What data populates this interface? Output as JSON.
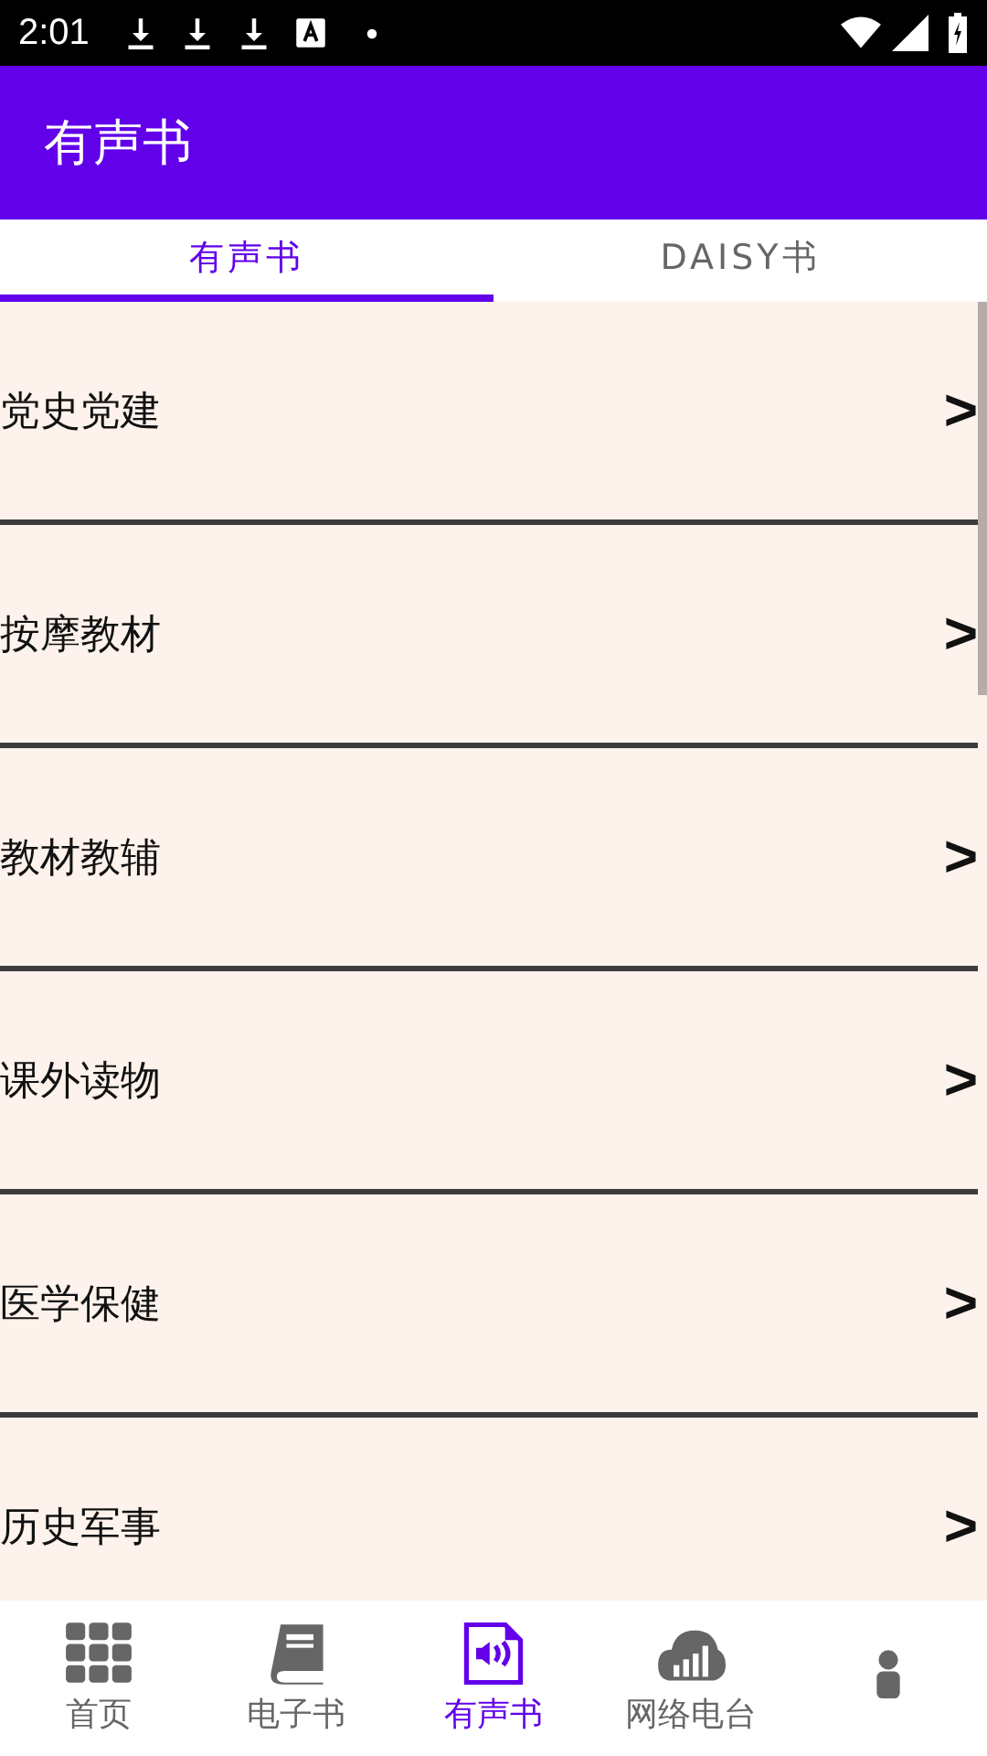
{
  "status_bar": {
    "time": "2:01"
  },
  "app_bar": {
    "title": "有声书"
  },
  "tabs": [
    {
      "label": "有声书",
      "selected": true
    },
    {
      "label": "DAISY书",
      "selected": false
    }
  ],
  "categories": [
    {
      "label": "党史党建",
      "arrow": ">"
    },
    {
      "label": "按摩教材",
      "arrow": ">"
    },
    {
      "label": "教材教辅",
      "arrow": ">"
    },
    {
      "label": "课外读物",
      "arrow": ">"
    },
    {
      "label": "医学保健",
      "arrow": ">"
    },
    {
      "label": "历史军事",
      "arrow": ">"
    }
  ],
  "bottom_nav": [
    {
      "kind": "grid",
      "label": "首页",
      "selected": false
    },
    {
      "kind": "book",
      "label": "电子书",
      "selected": false
    },
    {
      "kind": "audio",
      "label": "有声书",
      "selected": true
    },
    {
      "kind": "cloud",
      "label": "网络电台",
      "selected": false
    },
    {
      "kind": "person",
      "selected": false
    }
  ]
}
